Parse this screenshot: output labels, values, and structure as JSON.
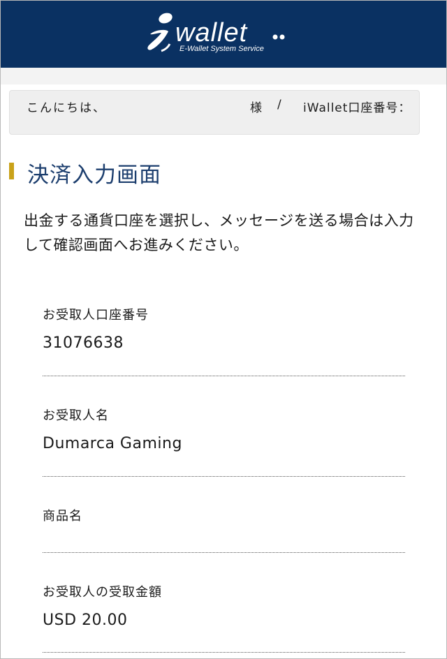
{
  "brand": {
    "name": "wallet",
    "prefix": "i",
    "dots": "..",
    "tagline": "E-Wallet System Service",
    "bg_color": "#0a3162",
    "accent_color": "#c9a21a"
  },
  "greeting": {
    "hello": "こんにちは、",
    "honorific": "様",
    "separator": "/",
    "account_label": "iWallet口座番号："
  },
  "page": {
    "title": "決済入力画面",
    "intro": "出金する通貨口座を選択し、メッセージを送る場合は入力して確認画面へお進みください。"
  },
  "fields": [
    {
      "label": "お受取人口座番号",
      "value": "31076638"
    },
    {
      "label": "お受取人名",
      "value": "Dumarca Gaming"
    },
    {
      "label": "商品名",
      "value": ""
    },
    {
      "label": "お受取人の受取金額",
      "value": "USD 20.00"
    }
  ]
}
